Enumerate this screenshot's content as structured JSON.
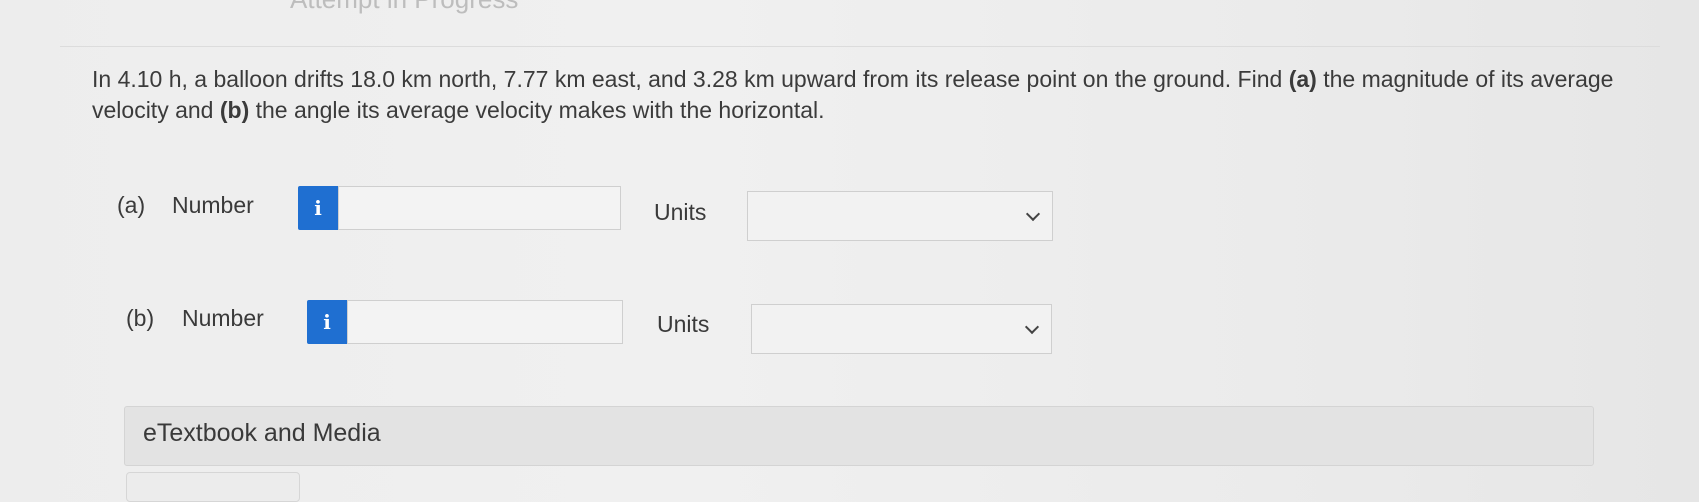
{
  "header": {
    "title": "Attempt in Progress"
  },
  "question": {
    "text_before_a": "In 4.10 h, a balloon drifts 18.0 km north, 7.77 km east, and 3.28 km upward from its release point on the ground. Find ",
    "label_a": "(a)",
    "text_between": " the magnitude of its average velocity and ",
    "label_b": "(b)",
    "text_after_b": " the angle its average velocity makes with the horizontal."
  },
  "parts": [
    {
      "label": "(a)",
      "number_label": "Number",
      "info_icon": "i",
      "number_value": "",
      "units_label": "Units",
      "units_selected": ""
    },
    {
      "label": "(b)",
      "number_label": "Number",
      "info_icon": "i",
      "number_value": "",
      "units_label": "Units",
      "units_selected": ""
    }
  ],
  "etextbook": {
    "label": "eTextbook and Media"
  },
  "colors": {
    "info_button": "#1f6fd1",
    "background": "#ededed"
  },
  "icons": {
    "info": "info-icon",
    "dropdown": "chevron-down-icon"
  }
}
